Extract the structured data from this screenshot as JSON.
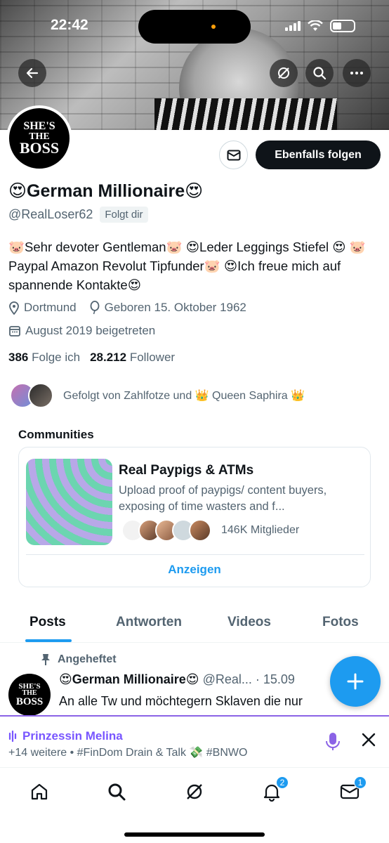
{
  "status_bar": {
    "time": "22:42"
  },
  "profile": {
    "avatar_text": [
      "SHE'S",
      "THE",
      "BOSS"
    ],
    "name": "😍German Millionaire😍",
    "handle": "@RealLoser62",
    "follows_you": "Folgt dir",
    "bio": "🐷Sehr devoter Gentleman🐷 😍Leder Leggings Stiefel 😍 🐷Paypal Amazon Revolut Tipfunder🐷 😍Ich freue mich auf spannende Kontakte😍",
    "location": "Dortmund",
    "birthday": "Geboren 15. Oktober 1962",
    "joined": "August 2019 beigetreten",
    "following_count": "386",
    "following_label": "Folge ich",
    "followers_count": "28.212",
    "followers_label": "Follower",
    "followed_by": "Gefolgt von Zahlfotze und 👑 Queen Saphira 👑"
  },
  "actions": {
    "follow_label": "Ebenfalls folgen"
  },
  "communities": {
    "title": "Communities",
    "card": {
      "name": "Real Paypigs & ATMs",
      "description": "Upload proof of paypigs/ content buyers, exposing of time wasters and f...",
      "members": "146K Mitglieder",
      "show_label": "Anzeigen"
    }
  },
  "tabs": [
    "Posts",
    "Antworten",
    "Videos",
    "Fotos"
  ],
  "post": {
    "pinned_label": "Angeheftet",
    "author": "😍German Millionaire😍",
    "handle_date": "@Real... · 15.09",
    "text": "An alle Tw und möchtegern Sklaven die nur"
  },
  "space": {
    "title": "Prinzessin Melina",
    "subtitle": "+14 weitere • #FinDom Drain & Talk 💸 #BNWO"
  },
  "nav": {
    "notifications_badge": "2",
    "messages_badge": "1"
  },
  "colors": {
    "accent": "#1d9bf0",
    "space_purple": "#7856ff"
  }
}
